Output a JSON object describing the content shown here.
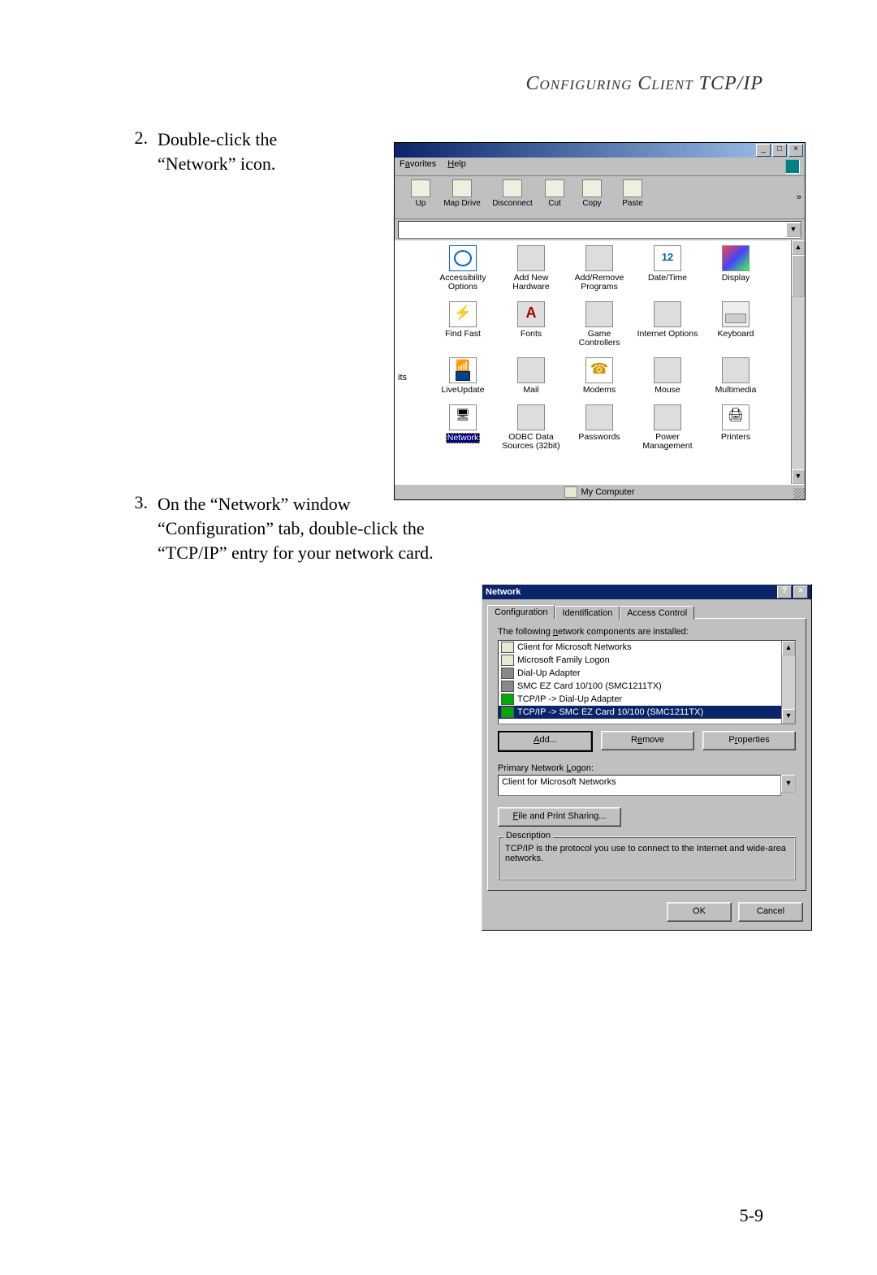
{
  "header": {
    "title": "Configuring Client TCP/IP"
  },
  "steps": {
    "s2": {
      "num": "2.",
      "text": "Double-click the “Network” icon."
    },
    "s3": {
      "num": "3.",
      "text": "On the “Network” window “Configuration” tab, double-click the “TCP/IP” entry for your network card."
    }
  },
  "controlPanel": {
    "menubar": {
      "favorites": "Favorites",
      "help": "Help"
    },
    "toolbar": {
      "up": "Up",
      "mapdrive": "Map Drive",
      "disconnect": "Disconnect",
      "cut": "Cut",
      "copy": "Copy",
      "paste": "Paste"
    },
    "leftFragment": "its",
    "icons": {
      "r1": {
        "a": "Accessibility Options",
        "b": "Add New Hardware",
        "c": "Add/Remove Programs",
        "d": "Date/Time",
        "e": "Display"
      },
      "r2": {
        "a": "Find Fast",
        "b": "Fonts",
        "c": "Game Controllers",
        "d": "Internet Options",
        "e": "Keyboard"
      },
      "r3": {
        "a": "LiveUpdate",
        "b": "Mail",
        "c": "Modems",
        "d": "Mouse",
        "e": "Multimedia"
      },
      "r4": {
        "a": "Network",
        "b": "ODBC Data Sources (32bit)",
        "c": "Passwords",
        "d": "Power Management",
        "e": "Printers"
      }
    },
    "status": "My Computer"
  },
  "networkDialog": {
    "title": "Network",
    "tabs": {
      "config": "Configuration",
      "ident": "Identification",
      "access": "Access Control"
    },
    "installedLabel": "The following network components are installed:",
    "list": {
      "i0": "Client for Microsoft Networks",
      "i1": "Microsoft Family Logon",
      "i2": "Dial-Up Adapter",
      "i3": "SMC EZ Card 10/100 (SMC1211TX)",
      "i4": "TCP/IP -> Dial-Up Adapter",
      "i5": "TCP/IP -> SMC EZ Card 10/100 (SMC1211TX)"
    },
    "buttons": {
      "add": "Add...",
      "remove": "Remove",
      "props": "Properties"
    },
    "primaryLogonLabel": "Primary Network Logon:",
    "primaryLogonValue": "Client for Microsoft Networks",
    "filePrint": "File and Print Sharing...",
    "descriptionLegend": "Description",
    "descriptionText": "TCP/IP is the protocol you use to connect to the Internet and wide-area networks.",
    "ok": "OK",
    "cancel": "Cancel"
  },
  "pageNumber": "5-9"
}
